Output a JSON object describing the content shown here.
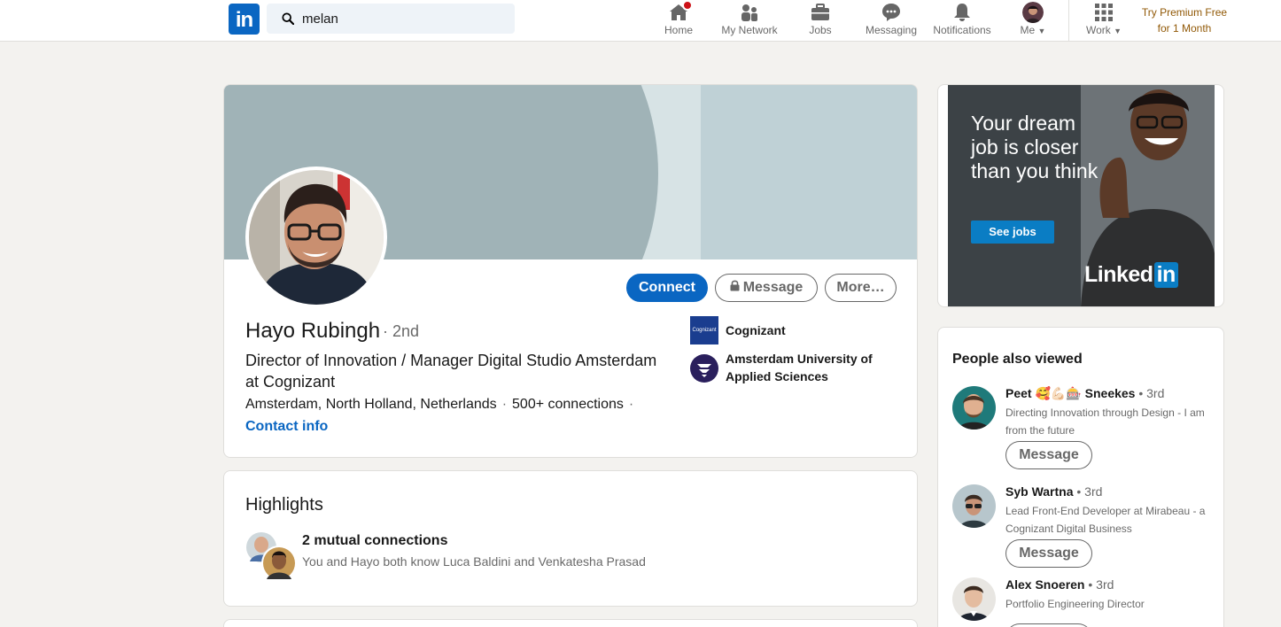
{
  "nav": {
    "logo": "in",
    "search_value": "melan",
    "items": [
      {
        "label": "Home",
        "icon": "home-icon"
      },
      {
        "label": "My Network",
        "icon": "network-icon"
      },
      {
        "label": "Jobs",
        "icon": "briefcase-icon"
      },
      {
        "label": "Messaging",
        "icon": "messaging-icon"
      },
      {
        "label": "Notifications",
        "icon": "bell-icon"
      },
      {
        "label": "Me",
        "icon": "profile-photo"
      },
      {
        "label": "Work",
        "icon": "grid-icon"
      }
    ],
    "premium_line1": "Try Premium Free",
    "premium_line2": "for 1 Month"
  },
  "profile": {
    "name": "Hayo Rubingh",
    "degree": "· 2nd",
    "headline": "Director of Innovation / Manager Digital Studio Amsterdam at Cognizant",
    "location": "Amsterdam, North Holland, Netherlands",
    "connections": "500+ connections",
    "contact_info": "Contact info",
    "buttons": {
      "connect": "Connect",
      "message": "Message",
      "more": "More…"
    },
    "orgs": [
      {
        "name": "Cognizant",
        "logo_text": "Cognizant"
      },
      {
        "name": "Amsterdam University of Applied Sciences"
      }
    ]
  },
  "highlights": {
    "title": "Highlights",
    "mutual": "2 mutual connections",
    "mutual_detail": "You and Hayo both know Luca Baldini and Venkatesha Prasad"
  },
  "ad": {
    "headline": "Your dream job is closer than you think",
    "cta": "See jobs",
    "brand": "Linked",
    "brand_in": "in"
  },
  "people_also_viewed": {
    "title": "People also viewed",
    "people": [
      {
        "name": "Peet 🥰💪🏻🎰 Sneekes",
        "degree": "• 3rd",
        "headline": "Directing Innovation through Design - I am from the future",
        "button": "Message"
      },
      {
        "name": "Syb Wartna",
        "degree": "• 3rd",
        "headline": "Lead Front-End Developer at Mirabeau - a Cognizant Digital Business",
        "button": "Message"
      },
      {
        "name": "Alex Snoeren",
        "degree": "• 3rd",
        "headline": "Portfolio Engineering Director"
      }
    ]
  },
  "colors": {
    "brand_blue": "#0a66c2",
    "notification_red": "#cc1016",
    "premium_gold": "#915907",
    "page_bg": "#f3f2ef"
  }
}
